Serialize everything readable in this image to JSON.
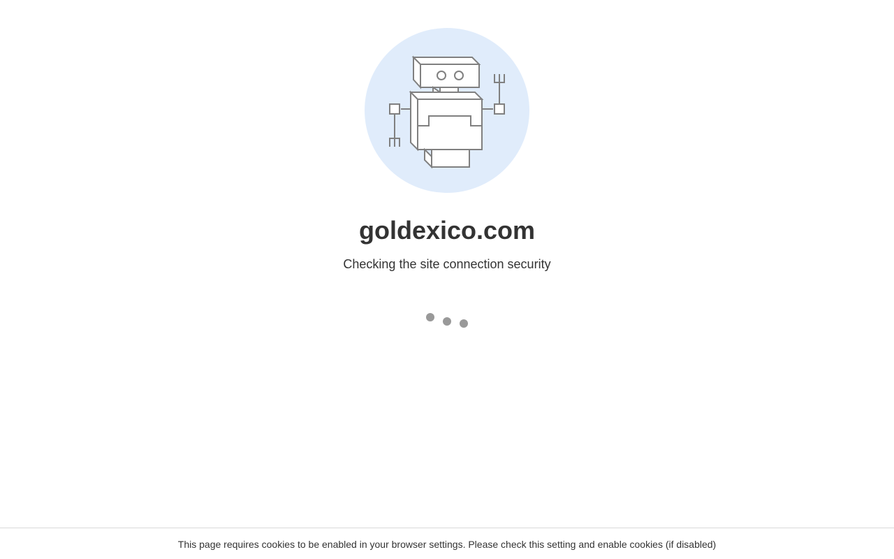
{
  "site": {
    "domain": "goldexico.com",
    "status": "Checking the site connection security"
  },
  "illustration": {
    "icon": "robot-icon",
    "circle_color": "#e0ecfb",
    "stroke_color": "#808080"
  },
  "loader": {
    "icon": "loading-dots-icon",
    "dot_color": "#999999"
  },
  "footer": {
    "notice": "This page requires cookies to be enabled in your browser settings. Please check this setting and enable cookies (if disabled)"
  }
}
